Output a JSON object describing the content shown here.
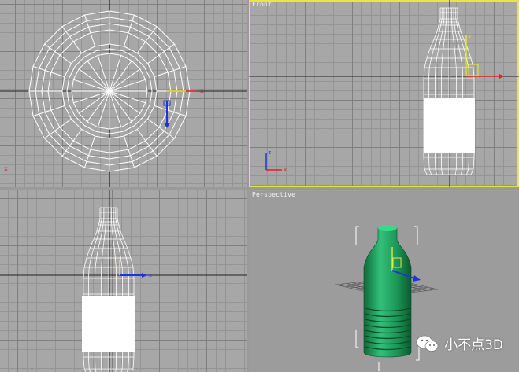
{
  "viewports": {
    "top": {
      "label": ""
    },
    "front": {
      "label": "Front"
    },
    "left": {
      "label": ""
    },
    "perspective": {
      "label": "Perspective"
    }
  },
  "watermark": {
    "text": "小不点3D",
    "icon": "wechat-icon"
  },
  "colors": {
    "wireframe": "#ffffff",
    "active_border": "#e8e83a",
    "gizmo_x": "#e02020",
    "gizmo_y": "#e8e83a",
    "gizmo_z": "#1a35d8",
    "bottle_shaded": "#1fa35a"
  }
}
